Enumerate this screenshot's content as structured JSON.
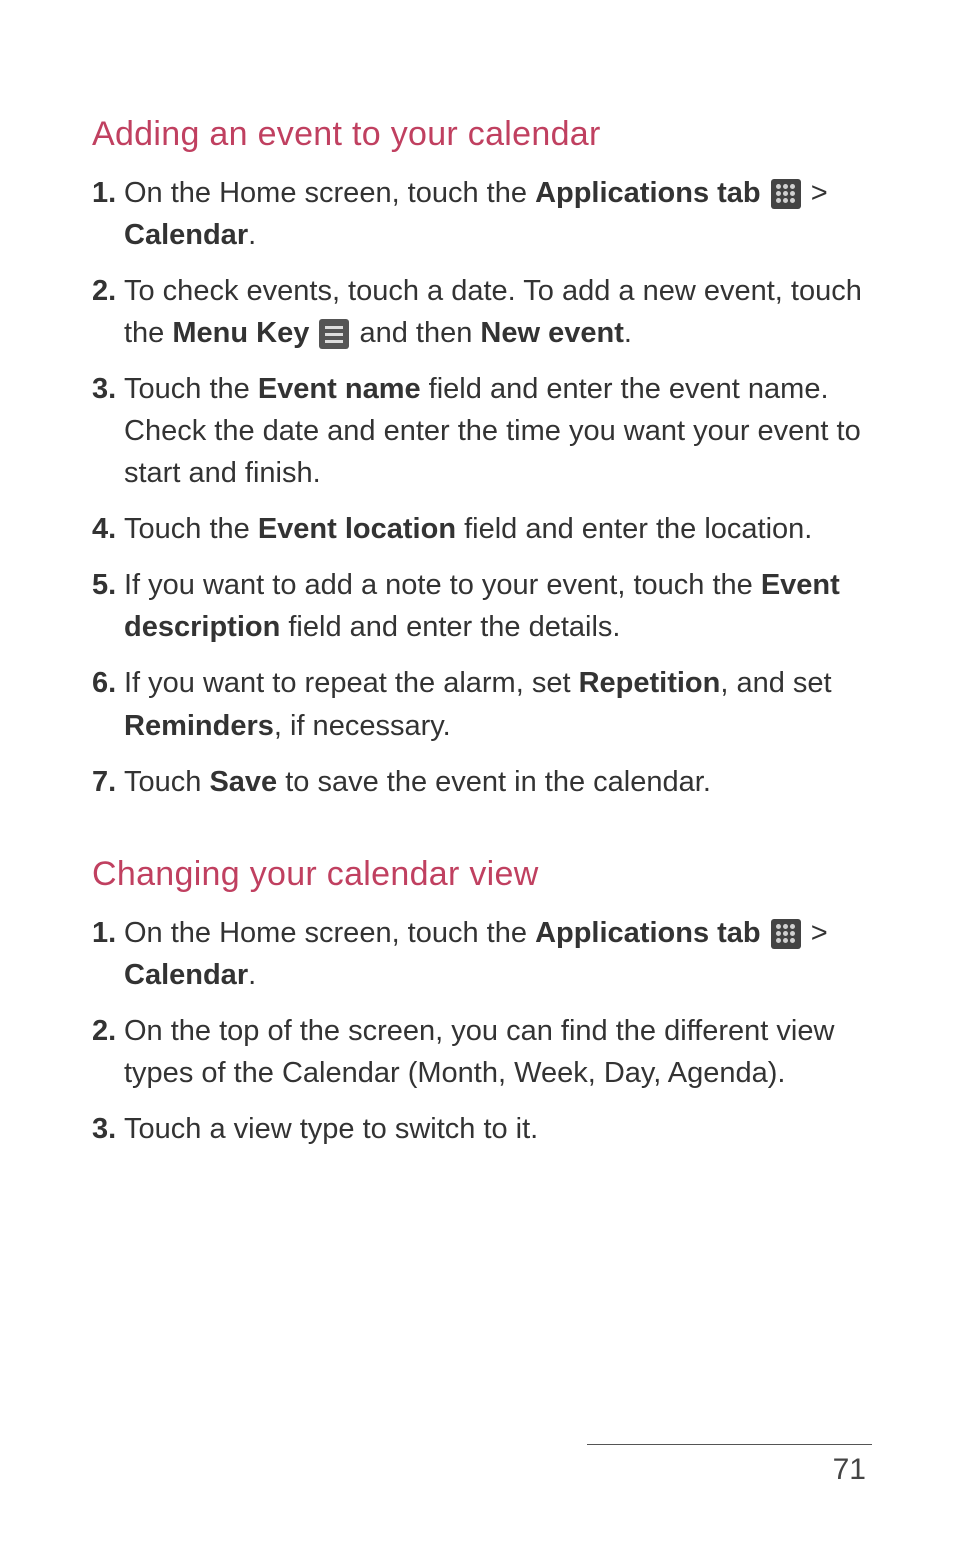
{
  "section1": {
    "heading": "Adding an event to your calendar",
    "items": [
      {
        "num": "1.",
        "parts": [
          {
            "t": " On the Home screen, touch the "
          },
          {
            "t": "Applications tab ",
            "b": true
          },
          {
            "icon": "apps"
          },
          {
            "t": " > "
          },
          {
            "t": "Calendar",
            "b": true
          },
          {
            "t": "."
          }
        ]
      },
      {
        "num": "2.",
        "parts": [
          {
            "t": "To check events, touch a date. To add a new event, touch the "
          },
          {
            "t": "Menu Key ",
            "b": true
          },
          {
            "icon": "menu"
          },
          {
            "t": " and then "
          },
          {
            "t": "New event",
            "b": true
          },
          {
            "t": "."
          }
        ]
      },
      {
        "num": "3.",
        "parts": [
          {
            "t": "Touch the "
          },
          {
            "t": "Event name",
            "b": true
          },
          {
            "t": " field and enter the event name. Check the date and enter the time you want your event to start and finish."
          }
        ]
      },
      {
        "num": "4.",
        "parts": [
          {
            "t": "Touch the "
          },
          {
            "t": "Event location",
            "b": true
          },
          {
            "t": " field and enter the location."
          }
        ]
      },
      {
        "num": "5.",
        "parts": [
          {
            "t": "If you want to add a note to your event, touch the "
          },
          {
            "t": "Event description",
            "b": true
          },
          {
            "t": " field and enter the details."
          }
        ]
      },
      {
        "num": "6.",
        "parts": [
          {
            "t": "If you want to repeat the alarm, set "
          },
          {
            "t": "Repetition",
            "b": true
          },
          {
            "t": ", and set "
          },
          {
            "t": "Reminders",
            "b": true
          },
          {
            "t": ", if necessary."
          }
        ]
      },
      {
        "num": "7.",
        "parts": [
          {
            "t": " Touch "
          },
          {
            "t": "Save",
            "b": true
          },
          {
            "t": " to save the event in the calendar."
          }
        ]
      }
    ]
  },
  "section2": {
    "heading": "Changing your calendar view",
    "items": [
      {
        "num": "1.",
        "parts": [
          {
            "t": " On the Home screen, touch the "
          },
          {
            "t": "Applications tab ",
            "b": true
          },
          {
            "icon": "apps"
          },
          {
            "t": " > "
          },
          {
            "t": "Calendar",
            "b": true
          },
          {
            "t": "."
          }
        ]
      },
      {
        "num": "2.",
        "parts": [
          {
            "t": "On the top of the screen, you can find the different view types of the Calendar (Month, Week, Day, Agenda)."
          }
        ]
      },
      {
        "num": "3.",
        "parts": [
          {
            "t": "Touch a view type to switch to it."
          }
        ]
      }
    ]
  },
  "pageNumber": "71"
}
